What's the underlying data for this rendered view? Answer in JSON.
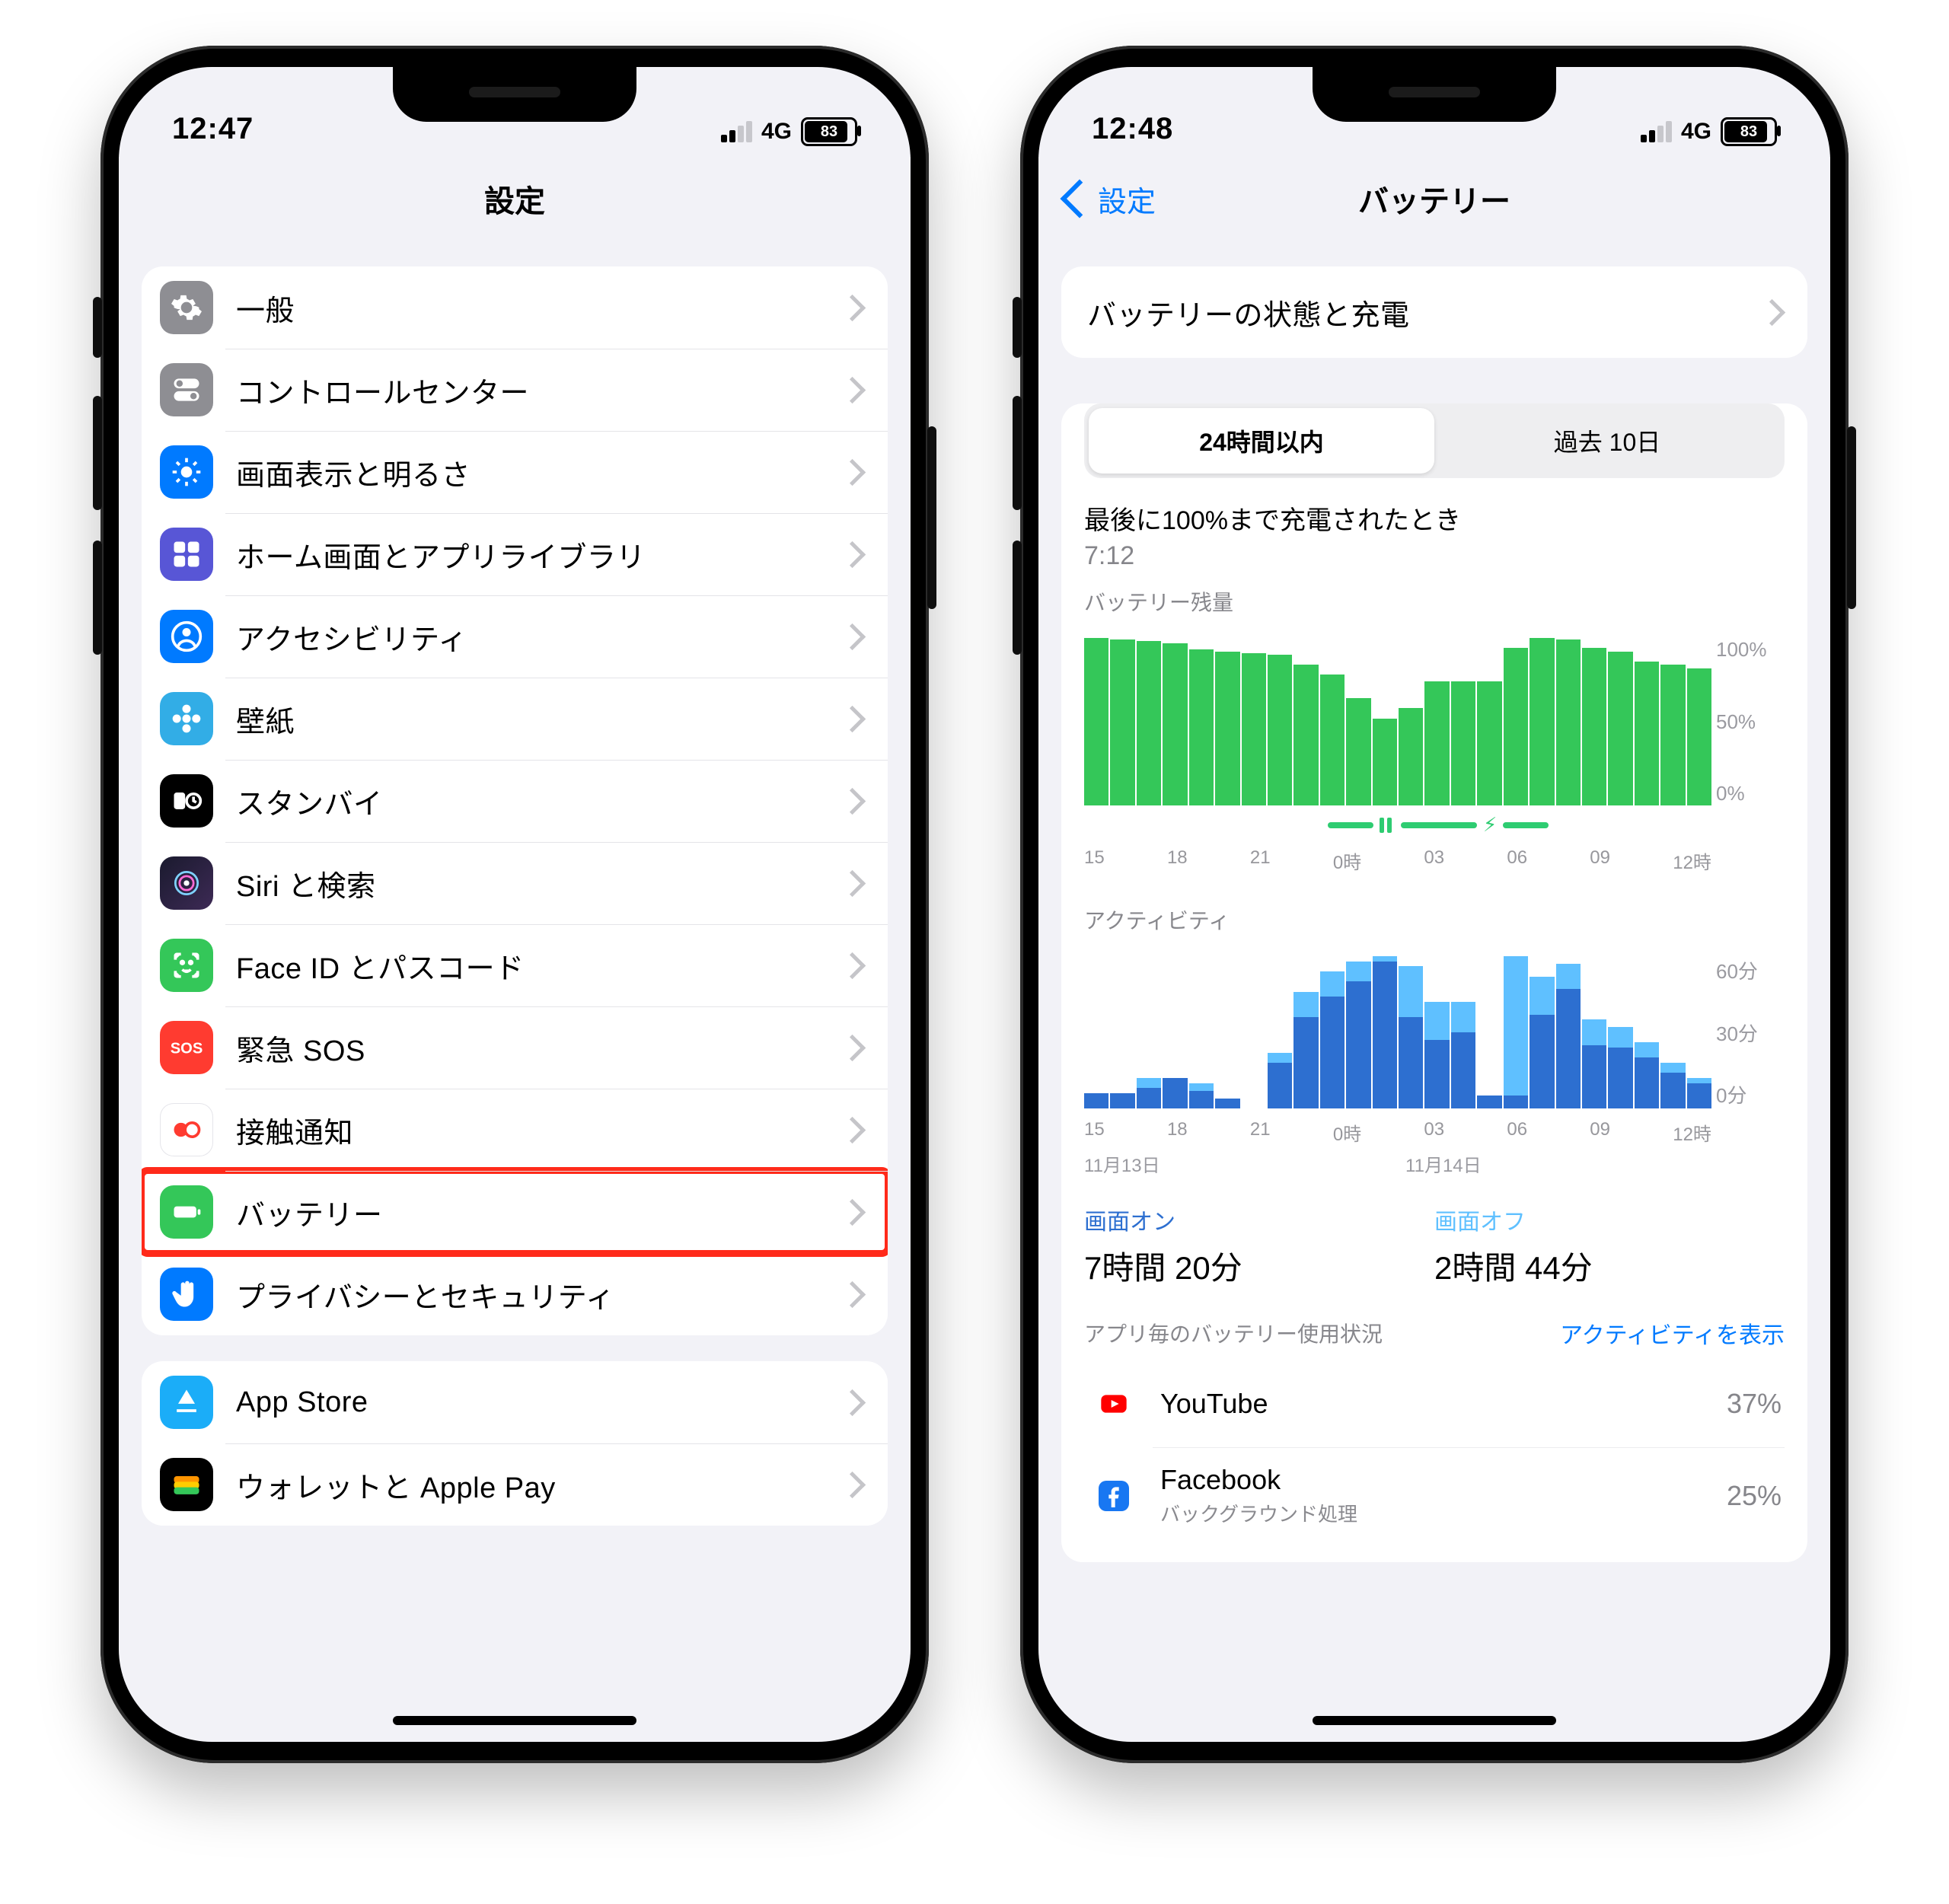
{
  "left": {
    "status": {
      "time": "12:47",
      "network": "4G",
      "battery_pct": "83"
    },
    "nav": {
      "title": "設定"
    },
    "groups": [
      {
        "rows": [
          {
            "id": "general",
            "label": "一般",
            "icon_bg": "bg-grey",
            "icon": "gear"
          },
          {
            "id": "control-center",
            "label": "コントロールセンター",
            "icon_bg": "bg-grey",
            "icon": "toggles"
          },
          {
            "id": "display",
            "label": "画面表示と明るさ",
            "icon_bg": "bg-blue",
            "icon": "sun"
          },
          {
            "id": "home-screen",
            "label": "ホーム画面とアプリライブラリ",
            "icon_bg": "bg-indigo",
            "icon": "grid"
          },
          {
            "id": "accessibility",
            "label": "アクセシビリティ",
            "icon_bg": "bg-blue",
            "icon": "person"
          },
          {
            "id": "wallpaper",
            "label": "壁紙",
            "icon_bg": "bg-teal",
            "icon": "flower"
          },
          {
            "id": "standby",
            "label": "スタンバイ",
            "icon_bg": "bg-black",
            "icon": "clock"
          },
          {
            "id": "siri-search",
            "label": "Siri と検索",
            "icon_bg": "bg-siri",
            "icon": "siri"
          },
          {
            "id": "faceid",
            "label": "Face ID とパスコード",
            "icon_bg": "bg-green",
            "icon": "faceid"
          },
          {
            "id": "sos",
            "label": "緊急 SOS",
            "icon_bg": "bg-red",
            "icon": "sos"
          },
          {
            "id": "exposure",
            "label": "接触通知",
            "icon_bg": "bg-white",
            "icon": "exposure"
          },
          {
            "id": "battery",
            "label": "バッテリー",
            "icon_bg": "bg-green",
            "icon": "battery",
            "highlight": true
          },
          {
            "id": "privacy",
            "label": "プライバシーとセキュリティ",
            "icon_bg": "bg-blue",
            "icon": "hand"
          }
        ]
      },
      {
        "rows": [
          {
            "id": "appstore",
            "label": "App Store",
            "icon_bg": "bg-ltblue",
            "icon": "appstore"
          },
          {
            "id": "wallet",
            "label": "ウォレットと Apple Pay",
            "icon_bg": "bg-black",
            "icon": "wallet"
          }
        ]
      }
    ]
  },
  "right": {
    "status": {
      "time": "12:48",
      "network": "4G",
      "battery_pct": "83"
    },
    "nav": {
      "back": "設定",
      "title": "バッテリー"
    },
    "health_row": "バッテリーの状態と充電",
    "segmented": {
      "options": [
        "24時間以内",
        "過去 10日"
      ],
      "selected_index": 0
    },
    "last_charge": {
      "label": "最後に100%まで充電されたとき",
      "time": "7:12"
    },
    "battery_chart": {
      "title": "バッテリー残量",
      "y_ticks": [
        "100%",
        "50%",
        "0%"
      ],
      "x_ticks": [
        "15",
        "18",
        "21",
        "0時",
        "03",
        "06",
        "09",
        "12時"
      ]
    },
    "activity_chart": {
      "title": "アクティビティ",
      "y_ticks": [
        "60分",
        "30分",
        "0分"
      ],
      "x_ticks": [
        "15",
        "18",
        "21",
        "0時",
        "03",
        "06",
        "09",
        "12時"
      ],
      "date_labels": [
        "11月13日",
        "11月14日"
      ]
    },
    "screen": {
      "on": {
        "label": "画面オン",
        "value": "7時間 20分"
      },
      "off": {
        "label": "画面オフ",
        "value": "2時間 44分"
      }
    },
    "usage_header": {
      "left": "アプリ毎のバッテリー使用状況",
      "right": "アクティビティを表示"
    },
    "apps": [
      {
        "id": "youtube",
        "name": "YouTube",
        "sub": "",
        "pct": "37%",
        "brand": "#ff0000"
      },
      {
        "id": "facebook",
        "name": "Facebook",
        "sub": "バックグラウンド処理",
        "pct": "25%",
        "brand": "#1877f2"
      }
    ]
  },
  "chart_data": [
    {
      "type": "bar",
      "title": "バッテリー残量",
      "ylabel": "%",
      "ylim": [
        0,
        100
      ],
      "categories_hours": [
        13,
        14,
        15,
        16,
        17,
        18,
        19,
        20,
        21,
        22,
        23,
        0,
        1,
        2,
        3,
        4,
        5,
        6,
        7,
        8,
        9,
        10,
        11,
        12
      ],
      "values": [
        100,
        99,
        98,
        97,
        93,
        92,
        91,
        90,
        84,
        78,
        64,
        52,
        58,
        74,
        74,
        74,
        94,
        100,
        99,
        94,
        92,
        86,
        84,
        82
      ]
    },
    {
      "type": "bar",
      "title": "アクティビティ",
      "ylabel": "分",
      "ylim": [
        0,
        60
      ],
      "categories_hours": [
        13,
        14,
        15,
        16,
        17,
        18,
        19,
        20,
        21,
        22,
        23,
        0,
        1,
        2,
        3,
        4,
        5,
        6,
        7,
        8,
        9,
        10,
        11,
        12
      ],
      "series": [
        {
          "name": "画面オン",
          "color": "#2d6fd0",
          "values": [
            6,
            6,
            8,
            12,
            7,
            4,
            0,
            18,
            36,
            44,
            50,
            58,
            36,
            27,
            30,
            5,
            5,
            37,
            47,
            25,
            24,
            20,
            14,
            10
          ]
        },
        {
          "name": "画面オフ",
          "color": "#5fc0ff",
          "values": [
            0,
            0,
            4,
            0,
            3,
            0,
            0,
            4,
            10,
            10,
            8,
            2,
            20,
            15,
            12,
            0,
            55,
            15,
            10,
            10,
            8,
            6,
            4,
            2
          ]
        }
      ]
    }
  ]
}
